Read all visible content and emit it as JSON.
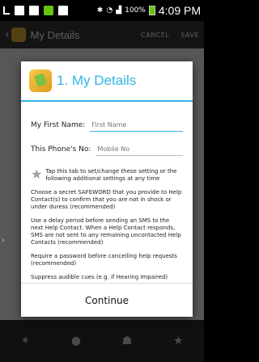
{
  "status_bar": {
    "time": "4:09 PM",
    "battery": "100%"
  },
  "app": {
    "title": "My Details",
    "cancel_label": "CANCEL",
    "save_label": "SAVE"
  },
  "dialog": {
    "title": "1. My Details",
    "first_name": {
      "label": "My First Name:",
      "placeholder": "First Name"
    },
    "phone_no": {
      "label": "This Phone's No:",
      "placeholder": "Mobile No"
    },
    "tip": "Tap this tab to set/change these setting or the following additional settings at any time",
    "paragraphs": [
      "Choose a secret SAFEWORD that you provide to Help Contact(s) to confirm that you are not in shock or under duress (recommended)",
      "Use a delay period before sending an SMS to the next Help Contact. When a Help Contact responds, SMS are not sent to any remaining uncontacted Help Contacts (recommended)",
      "Require a password before cancelling help requests (recommended)",
      "Suppress audible cues (e.g. if Hearing Impaired)"
    ],
    "continue_label": "Continue"
  },
  "colors": {
    "accent": "#33b5e5",
    "app_icon": "#e9b43a",
    "status_green": "#66c40d"
  }
}
